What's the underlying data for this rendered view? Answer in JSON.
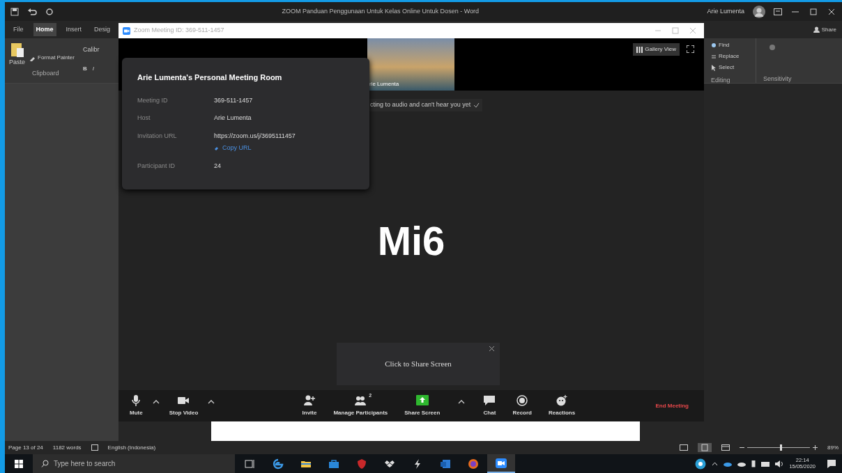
{
  "word": {
    "title": "ZOOM Panduan Penggunaan Untuk Kelas Online Untuk Dosen  -  Word",
    "user": "Arie Lumenta",
    "tabs": [
      {
        "label": "File",
        "selected": false
      },
      {
        "label": "Home",
        "selected": true
      },
      {
        "label": "Insert",
        "selected": false
      },
      {
        "label": "Desig",
        "selected": false
      }
    ],
    "share": "Share",
    "clipboard": {
      "paste": "Paste",
      "format_painter": "Format Painter",
      "group": "Clipboard"
    },
    "font": {
      "name": "Calibr",
      "bold": "B",
      "italic": "I"
    },
    "editing": {
      "find": "Find",
      "replace": "Replace",
      "select": "Select",
      "group": "Editing"
    },
    "sensitivity": "Sensitivity"
  },
  "zoom": {
    "title": "Zoom Meeting ID: 369-511-1457",
    "video_name": "rie Lumenta",
    "gallery_view": "Gallery View",
    "notice": "cting to audio and can't hear you yet",
    "card": {
      "title": "Arie Lumenta's Personal Meeting Room",
      "rows": [
        {
          "label": "Meeting ID",
          "value": "369-511-1457"
        },
        {
          "label": "Host",
          "value": "Arie Lumenta"
        },
        {
          "label": "Invitation URL",
          "value": "https://zoom.us/j/3695111457",
          "action": "Copy URL"
        },
        {
          "label": "Participant ID",
          "value": "24"
        }
      ]
    },
    "main_text": "Mi6",
    "share_popup": "Click to Share Screen",
    "toolbar": [
      {
        "kind": "mute",
        "label": "Mute",
        "caret": true
      },
      {
        "kind": "video",
        "label": "Stop Video",
        "caret": true
      },
      {
        "kind": "invite",
        "label": "Invite",
        "caret": false
      },
      {
        "kind": "participants",
        "label": "Manage Participants",
        "count": "2",
        "caret": false
      },
      {
        "kind": "share",
        "label": "Share Screen",
        "caret": true
      },
      {
        "kind": "chat",
        "label": "Chat",
        "caret": false
      },
      {
        "kind": "record",
        "label": "Record",
        "caret": false
      },
      {
        "kind": "reactions",
        "label": "Reactions",
        "caret": false
      }
    ],
    "end": "End Meeting"
  },
  "status_bar": {
    "page": "Page 13 of 24",
    "words": "1182 words",
    "language": "English (Indonesia)",
    "zoom_slider": {
      "level": 0.53
    },
    "zoom_percent": "89%"
  },
  "taskbar": {
    "search_placeholder": "Type here to search",
    "apps": [
      {
        "kind": "taskview",
        "active": false
      },
      {
        "kind": "edge",
        "active": false
      },
      {
        "kind": "files",
        "active": false
      },
      {
        "kind": "store",
        "active": false
      },
      {
        "kind": "shield",
        "active": false
      },
      {
        "kind": "dropbox",
        "active": false
      },
      {
        "kind": "bolt",
        "active": false
      },
      {
        "kind": "mail",
        "active": false
      },
      {
        "kind": "firefox",
        "active": false
      },
      {
        "kind": "zoom",
        "active": true
      }
    ],
    "time": "22:14",
    "date": "15/05/2020"
  }
}
